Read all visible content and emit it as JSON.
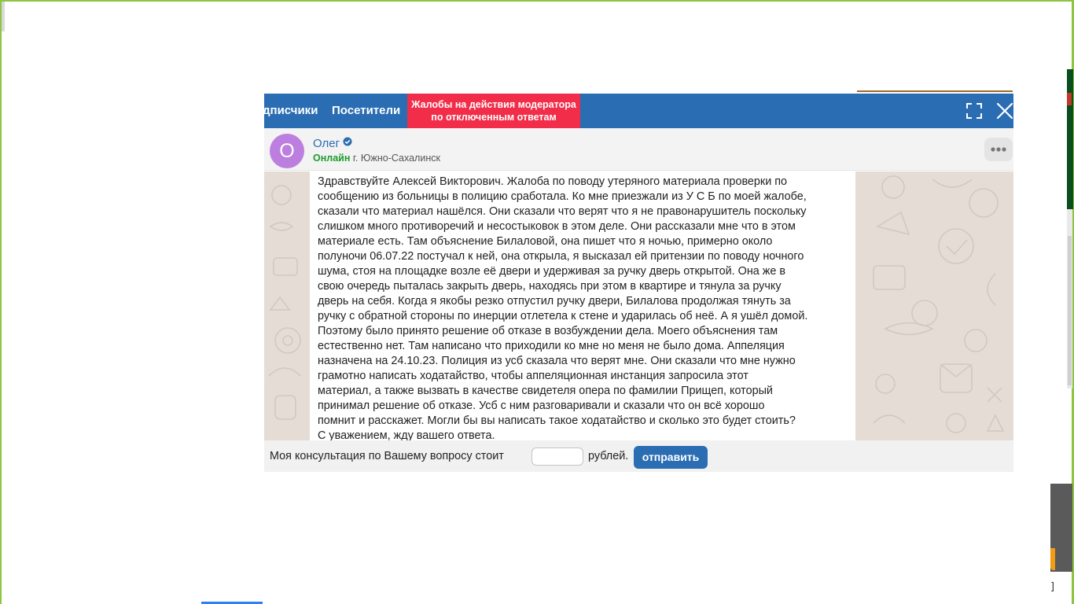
{
  "tabs": {
    "subscribers": "дписчики",
    "visitors": "Посетители",
    "complaints_line1": "Жалобы на действия модератора",
    "complaints_line2": "по отключенным ответам"
  },
  "icons": {
    "expand": "expand-icon",
    "close": "close-icon",
    "verified": "verified-icon",
    "more": "more-icon"
  },
  "user": {
    "initial": "О",
    "name": "Олег",
    "status": "Онлайн",
    "city": "г. Южно-Сахалинск"
  },
  "message": {
    "text": "Здравствуйте Алексей Викторович. Жалоба по поводу утеряного материала проверки по\nсообщению из больницы в полицию сработала. Ко мне приезжали из У С Б по моей жалобе,\nсказали что материал нашёлся. Они сказали что верят что я не правонарушитель поскольку\nслишком много противоречий и несостыковок в этом деле. Они рассказали мне что в этом\nматериале есть. Там объяснение Билаловой, она пишет что я ночью, примерно около\nполуночи 06.07.22 постучал к ней, она открыла, я высказал ей притензии по поводу ночного\nшума, стоя на площадке возле её двери и удерживая за ручку дверь открытой. Она же в\nсвою очередь пыталась закрыть дверь, находясь при этом в квартире и тянула за ручку\nдверь на себя. Когда я якобы резко отпустил ручку двери, Билалова продолжая тянуть за\nручку с обратной стороны по инерции отлетела к стене и ударилась об неё. А я ушёл домой.\nПоэтому было принято решение об отказе в возбуждении дела. Моего объяснения там\nестественно нет. Там написано что приходили ко мне но меня не было дома. Аппеляция\nназначена на 24.10.23. Полиция из усб сказала что верят мне. Они сказали что мне нужно\nграмотно написать ходатайство, чтобы аппеляционная инстанция запросила этот\nматериал, а также вызвать в качестве свидетеля опера по фамилии Прищеп, который\nпринимал решение об отказе. Усб с ним разговаривали и сказали что он всё хорошо\nпомнит и расскажет. Могли бы вы написать такое ходатайство и сколько это будет стоить?\nС уважением, жду вашего ответа."
  },
  "footer": {
    "label": "Моя консультация по Вашему вопросу стоит",
    "input_value": "",
    "input_placeholder": "",
    "unit": "рублей.",
    "send": "отправить"
  },
  "colors": {
    "topbar": "#2a6db3",
    "complaints_tab": "#f12d49",
    "avatar": "#bc7fe0",
    "online": "#1f9a2e",
    "chat_bg": "#e5ddd5",
    "page_border": "#8cc63f"
  }
}
